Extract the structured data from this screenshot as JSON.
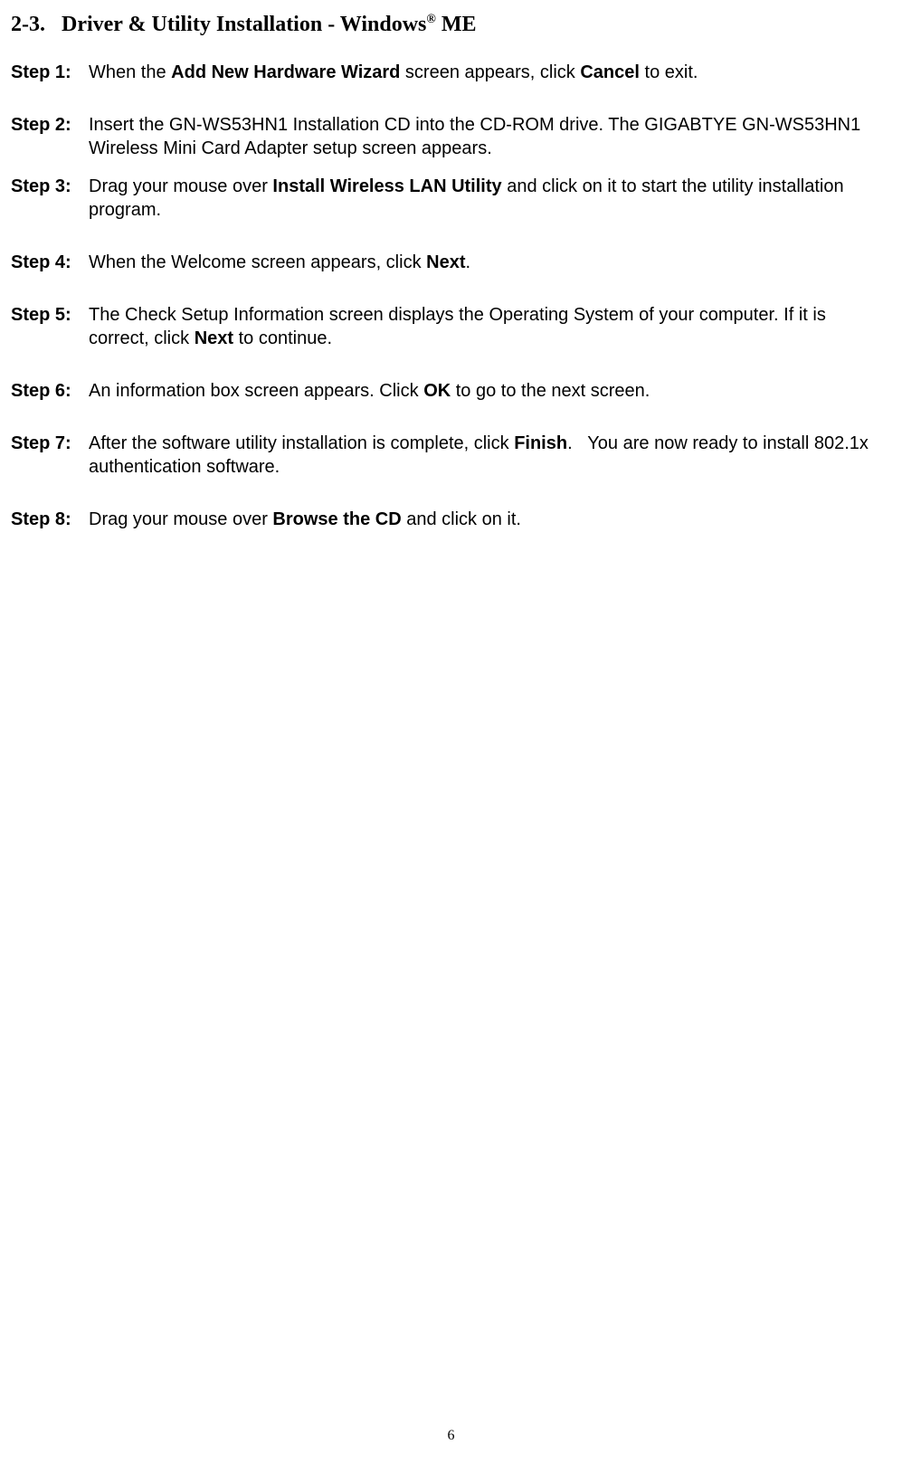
{
  "heading": {
    "number": "2-3.",
    "title_before": "Driver & Utility Installation - Windows",
    "title_sup": "®",
    "title_after": " ME"
  },
  "steps": {
    "s1": {
      "label": "Step 1:",
      "t1": "When the ",
      "b1": "Add New Hardware Wizard",
      "t2": " screen appears, click ",
      "b2": "Cancel",
      "t3": " to exit."
    },
    "s2": {
      "label": "Step 2:",
      "t1": "Insert the GN-WS53HN1 Installation CD into the CD-ROM drive. The GIGABTYE GN-WS53HN1 Wireless Mini Card Adapter setup screen appears."
    },
    "s3": {
      "label": "Step 3:",
      "t1": "Drag your mouse over ",
      "b1": "Install Wireless LAN Utility",
      "t2": " and click on it to start the utility installation program."
    },
    "s4": {
      "label": "Step 4:",
      "t1": "When the Welcome screen appears, click ",
      "b1": "Next",
      "t2": "."
    },
    "s5": {
      "label": "Step 5:",
      "t1": "The Check Setup Information screen displays the Operating System of your computer. If it is correct, click ",
      "b1": "Next",
      "t2": " to continue."
    },
    "s6": {
      "label": "Step 6:",
      "t1": "An information box screen appears. Click ",
      "b1": "OK",
      "t2": " to go to the next screen."
    },
    "s7": {
      "label": "Step 7:",
      "t1": "After the software utility installation is complete, click ",
      "b1": "Finish",
      "t2": ".   You are now ready to install 802.1x authentication software."
    },
    "s8": {
      "label": "Step 8:",
      "t1": "Drag your mouse over ",
      "b1": "Browse the CD",
      "t2": " and click on it."
    }
  },
  "page_number": "6"
}
